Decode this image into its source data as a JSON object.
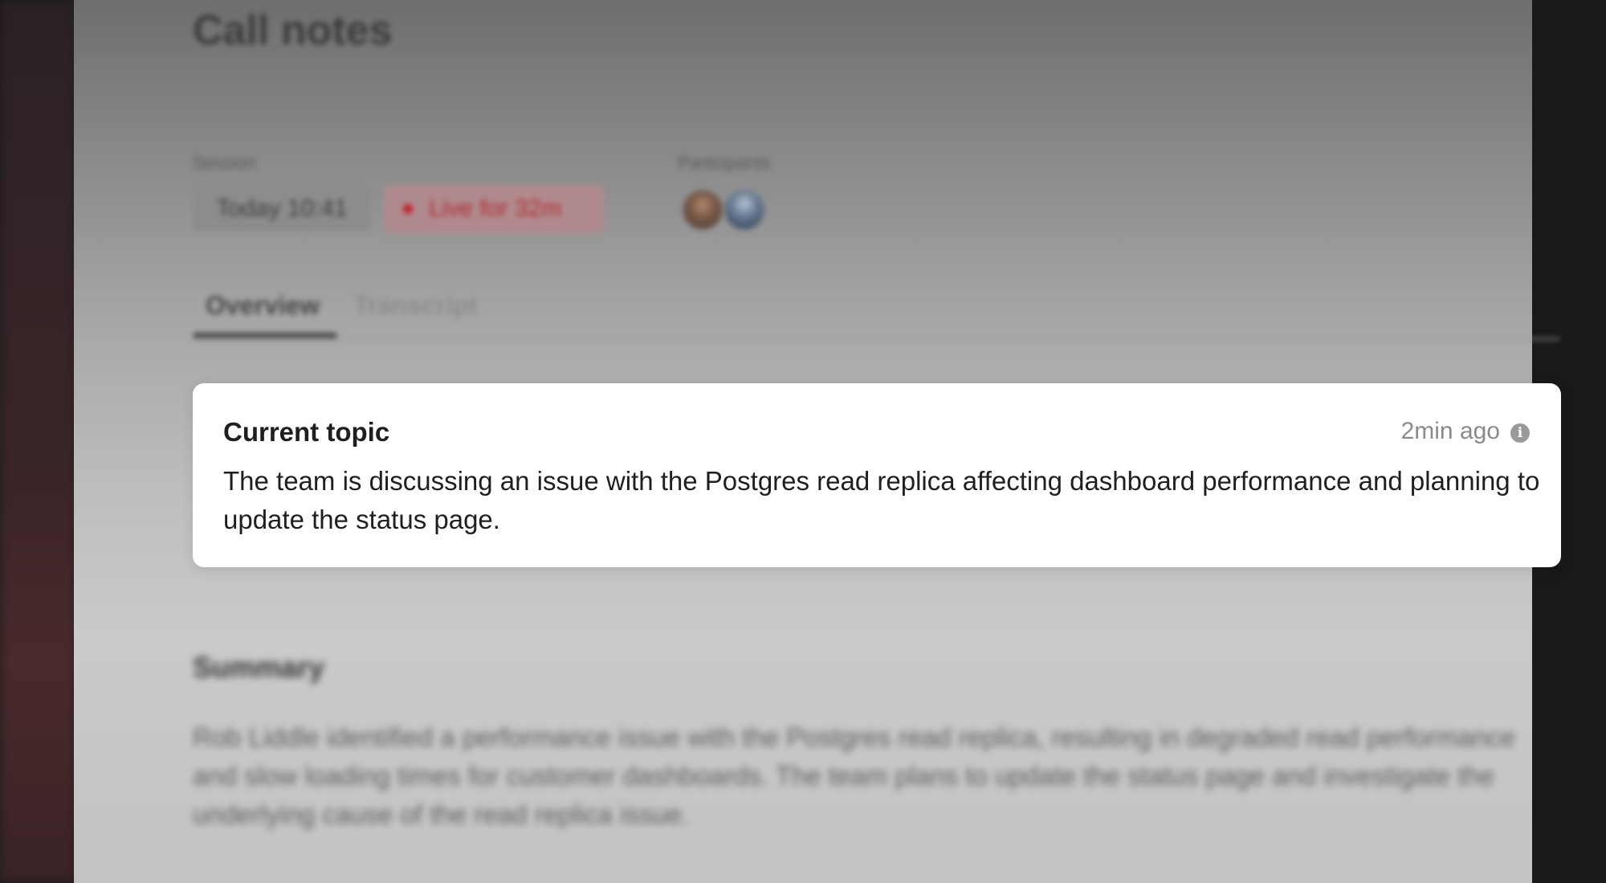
{
  "page": {
    "title": "Call notes"
  },
  "session": {
    "label": "Session",
    "time": "Today 10:41",
    "live_status": "Live for 32m"
  },
  "participants": {
    "label": "Participants",
    "avatars": [
      "participant-1",
      "participant-2"
    ]
  },
  "tabs": [
    {
      "label": "Overview",
      "active": true
    },
    {
      "label": "Transcript",
      "active": false
    }
  ],
  "current_topic": {
    "title": "Current topic",
    "updated": "2min ago",
    "text": "The team is discussing an issue with the Postgres read replica affecting dashboard performance and planning to update the status page."
  },
  "summary": {
    "title": "Summary",
    "text": "Rob Liddle identified a performance issue with the Postgres read replica, resulting in degraded read performance and slow loading times for customer dashboards. The team plans to update the status page and investigate the underlying cause of the read replica issue."
  },
  "colors": {
    "live_red": "#c41d28",
    "card_bg": "#ffffff",
    "text_primary": "#1f1f1f",
    "text_muted": "#8a8a8a"
  }
}
